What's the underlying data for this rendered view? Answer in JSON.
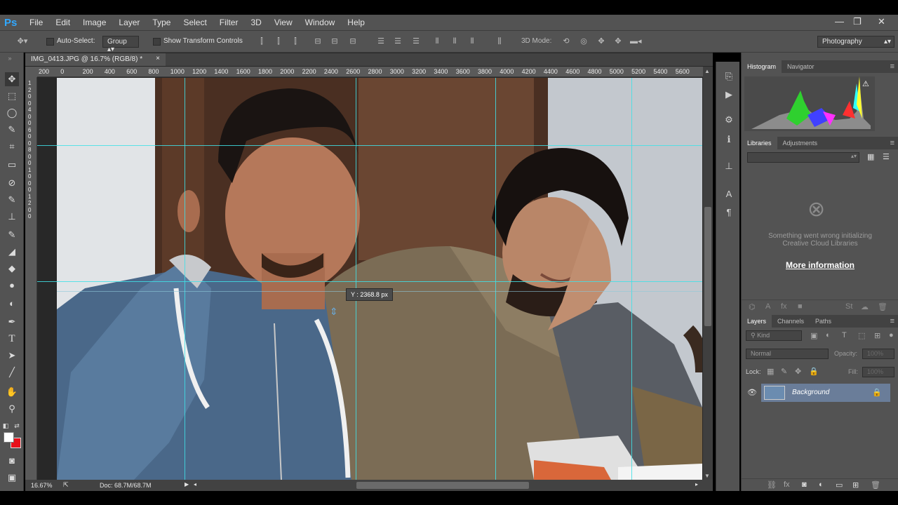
{
  "app": {
    "logo": "Ps",
    "menu": [
      "File",
      "Edit",
      "Image",
      "Layer",
      "Type",
      "Select",
      "Filter",
      "3D",
      "View",
      "Window",
      "Help"
    ],
    "window_controls": {
      "minimize": "—",
      "restore": "❐",
      "close": "✕"
    }
  },
  "options": {
    "auto_select_label": "Auto-Select:",
    "group_value": "Group",
    "show_transform_label": "Show Transform Controls",
    "mode_3d_label": "3D Mode:",
    "workspace": "Photography"
  },
  "document": {
    "tab_title": "IMG_0413.JPG @ 16.7% (RGB/8) *",
    "tab_close": "×",
    "ruler_h_labels": [
      "200",
      "0",
      "200",
      "400",
      "600",
      "800",
      "1000",
      "1200",
      "1400",
      "1600",
      "1800",
      "2000",
      "2200",
      "2400",
      "2600",
      "2800",
      "3000",
      "3200",
      "3400",
      "3600",
      "3800",
      "4000",
      "4200",
      "4400",
      "4600",
      "4800",
      "5000",
      "5200",
      "5400",
      "5600"
    ],
    "ruler_v_labels": [
      "1",
      "2",
      "0",
      "0",
      "4",
      "0",
      "0",
      "6",
      "0",
      "0",
      "8",
      "0",
      "0",
      "1",
      "0",
      "0",
      "0",
      "1",
      "2",
      "0",
      "0"
    ],
    "guide_tooltip": "Y :  2368.8 px",
    "zoom": "16.67%",
    "doc_size": "Doc: 68.7M/68.7M"
  },
  "panels": {
    "histogram_tabs": [
      "Histogram",
      "Navigator"
    ],
    "libraries_tabs": [
      "Libraries",
      "Adjustments"
    ],
    "library_error": "Something went wrong initializing Creative Cloud Libraries",
    "more_info": "More information",
    "layers_tabs": [
      "Layers",
      "Channels",
      "Paths"
    ],
    "kind_label": "Kind",
    "blend_mode": "Normal",
    "opacity_label": "Opacity:",
    "opacity_value": "100%",
    "lock_label": "Lock:",
    "fill_label": "Fill:",
    "fill_value": "100%",
    "layer_name": "Background"
  },
  "colors": {
    "ps_blue": "#31a8ff",
    "guide": "#3fe0e6",
    "ui_panel": "#535353",
    "selected_layer": "#6a7d99",
    "foreground": "#ffffff",
    "background": "#e8101a"
  }
}
